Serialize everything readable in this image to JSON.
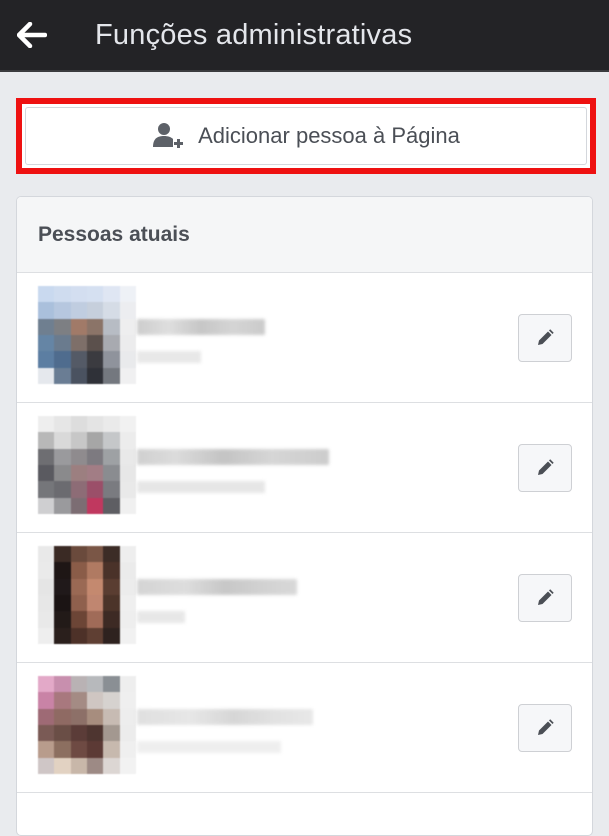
{
  "header": {
    "title": "Funções administrativas",
    "back_icon": "arrow-left-icon"
  },
  "add_person": {
    "label": "Adicionar pessoa à Página",
    "icon": "add-person-icon",
    "highlight_color": "#ee1111"
  },
  "people_section": {
    "title": "Pessoas atuais",
    "rows": [
      {
        "edit_icon": "pencil-icon"
      },
      {
        "edit_icon": "pencil-icon"
      },
      {
        "edit_icon": "pencil-icon"
      },
      {
        "edit_icon": "pencil-icon"
      }
    ]
  },
  "colors": {
    "topbar": "#232326",
    "background": "#e9ebee",
    "accent": "#4b4f56"
  }
}
